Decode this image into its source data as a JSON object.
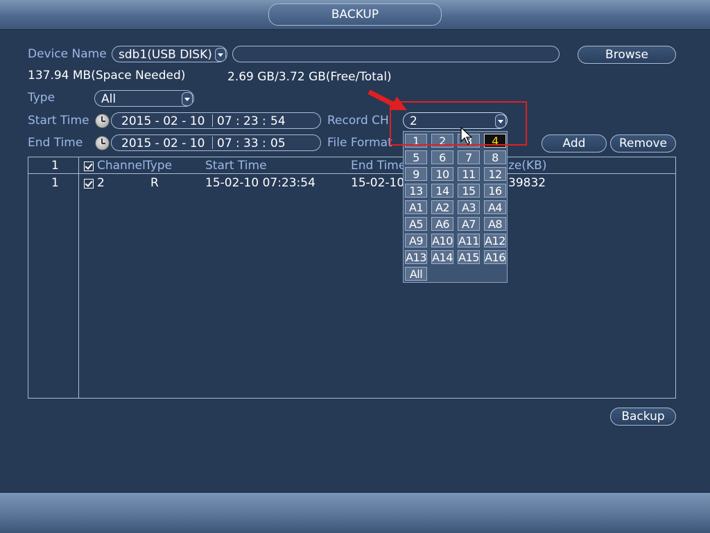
{
  "title": "BACKUP",
  "device": {
    "label": "Device Name",
    "value": "sdb1(USB DISK)",
    "path_value": "",
    "browse_label": "Browse"
  },
  "space_needed": "137.94 MB(Space Needed)",
  "free_total": "2.69 GB/3.72 GB(Free/Total)",
  "type": {
    "label": "Type",
    "value": "All"
  },
  "start_time": {
    "label": "Start Time",
    "date": "2015 - 02 - 10",
    "h": "07",
    "m": "23",
    "s": "54"
  },
  "end_time": {
    "label": "End Time",
    "date": "2015 - 02 - 10",
    "h": "07",
    "m": "33",
    "s": "05"
  },
  "record_ch": {
    "label": "Record CH",
    "value": "2"
  },
  "file_format": {
    "label": "File Format"
  },
  "buttons": {
    "add": "Add",
    "remove": "Remove",
    "backup": "Backup"
  },
  "table": {
    "headers": {
      "index": "1",
      "channel": "Channel",
      "type": "Type",
      "start_time": "Start Time",
      "end_time": "End Time",
      "size": "ze(KB)"
    },
    "rows": [
      {
        "index": "1",
        "channel": "2",
        "type": "R",
        "start_time": "15-02-10 07:23:54",
        "end_time": "15-02-10",
        "size": "39832"
      }
    ]
  },
  "channel_popup": {
    "items": [
      [
        "1",
        "2",
        "3",
        "4"
      ],
      [
        "5",
        "6",
        "7",
        "8"
      ],
      [
        "9",
        "10",
        "11",
        "12"
      ],
      [
        "13",
        "14",
        "15",
        "16"
      ],
      [
        "A1",
        "A2",
        "A3",
        "A4"
      ],
      [
        "A5",
        "A6",
        "A7",
        "A8"
      ],
      [
        "A9",
        "A10",
        "A11",
        "A12"
      ],
      [
        "A13",
        "A14",
        "A15",
        "A16"
      ],
      [
        "All"
      ]
    ],
    "selected": "4"
  },
  "colors": {
    "label_blue": "#9db8e8",
    "highlight_red": "#e02020",
    "selected_text": "#ffd400"
  }
}
